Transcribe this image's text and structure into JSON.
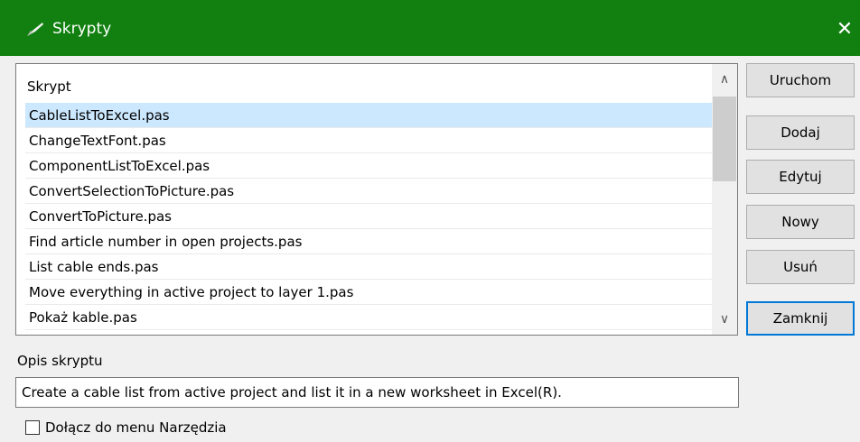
{
  "window": {
    "title": "Skrypty",
    "title_icon": "quill-pen-icon",
    "close_glyph": "✕",
    "accent_color": "#118010"
  },
  "script_list": {
    "header": "Skrypt",
    "selected_index": 0,
    "items": [
      "CableListToExcel.pas",
      "ChangeTextFont.pas",
      "ComponentListToExcel.pas",
      "ConvertSelectionToPicture.pas",
      "ConvertToPicture.pas",
      "Find article number in open projects.pas",
      "List cable ends.pas",
      "Move everything in active project to layer 1.pas",
      "Pokaż kable.pas"
    ],
    "scroll_up_glyph": "∧",
    "scroll_down_glyph": "∨"
  },
  "buttons": {
    "run": "Uruchom",
    "add": "Dodaj",
    "edit": "Edytuj",
    "new": "Nowy",
    "delete": "Usuń",
    "close": "Zamknij"
  },
  "description": {
    "label": "Opis skryptu",
    "value": "Create a cable list from active project and list it in a new worksheet in Excel(R)."
  },
  "menu_option": {
    "label": "Dołącz do menu Narzędzia",
    "checked": false
  }
}
